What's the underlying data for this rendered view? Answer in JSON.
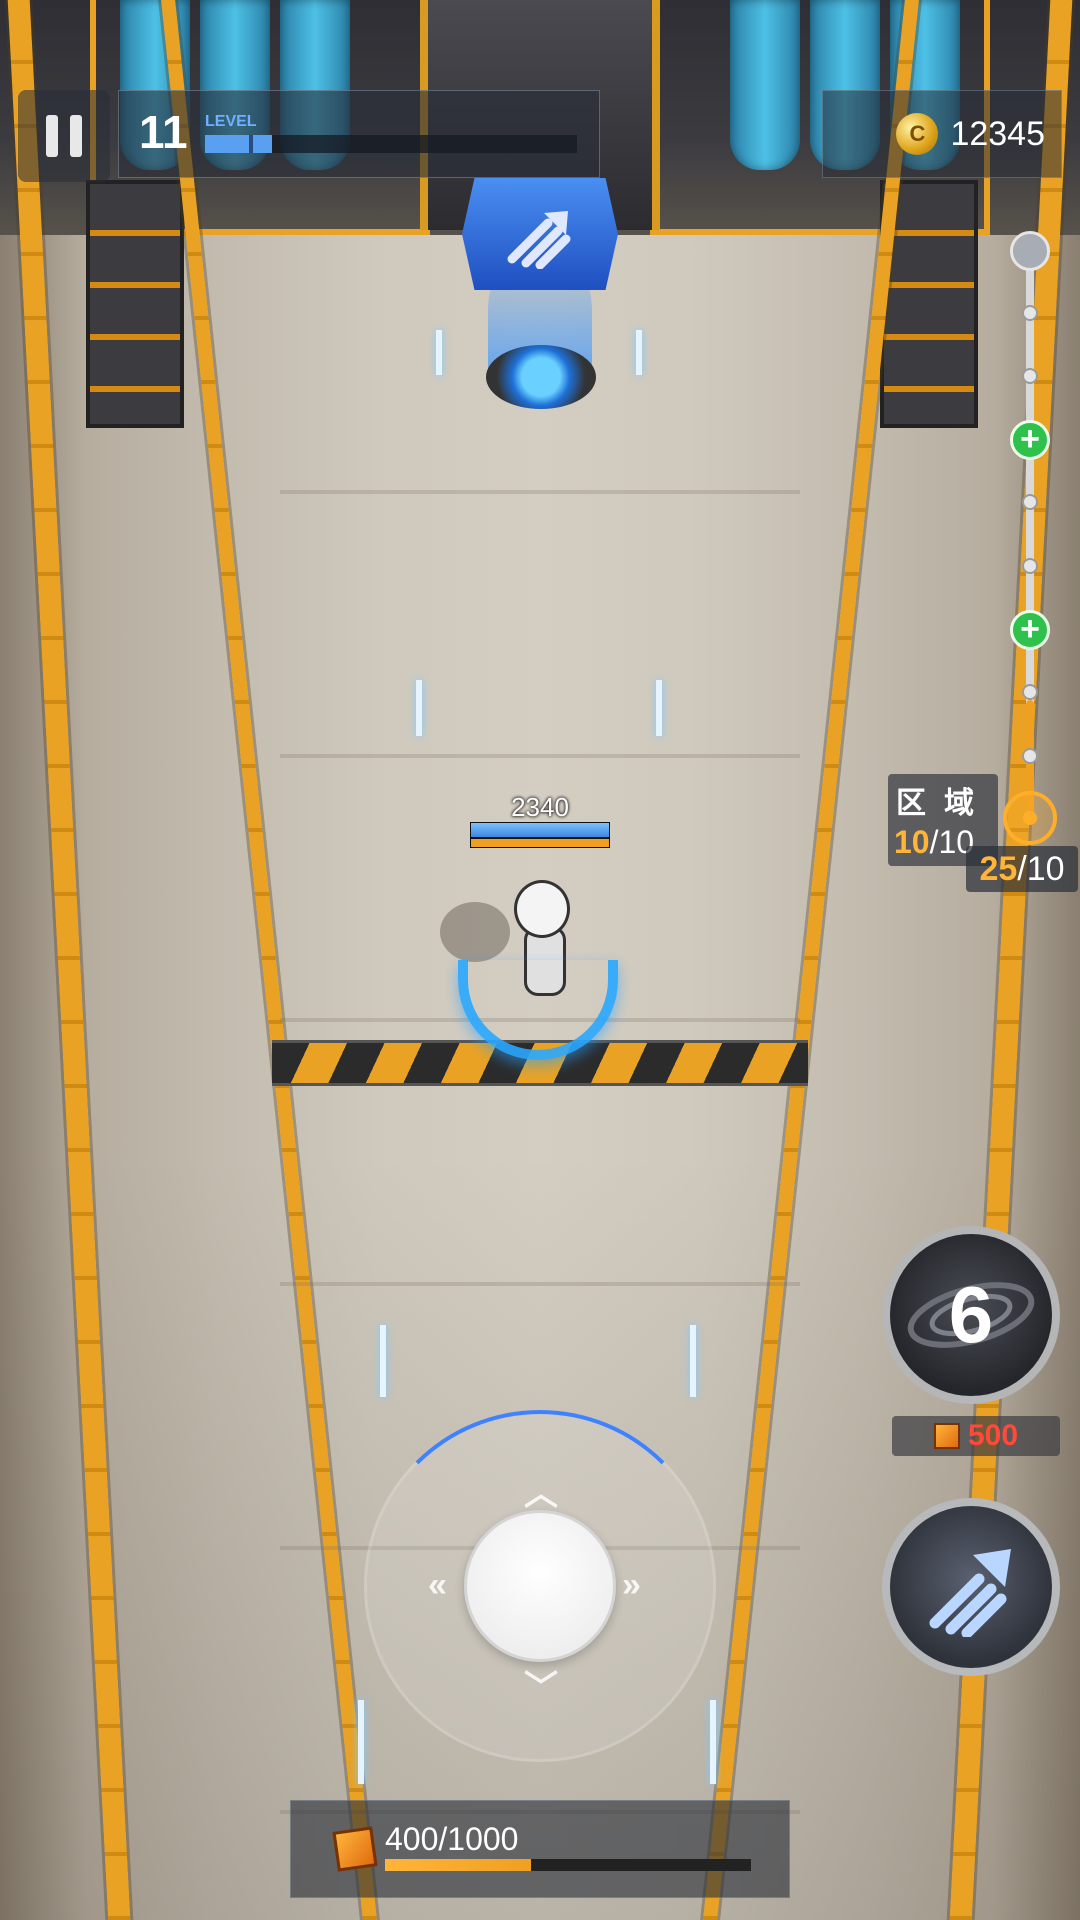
{
  "hud": {
    "level_value": "11",
    "level_word": "LEVEL",
    "level_progress": 0.18,
    "coins": "12345"
  },
  "zone": {
    "label": "区域",
    "current": "10",
    "total": "10"
  },
  "kills": {
    "current": "25",
    "total": "10"
  },
  "player": {
    "hp_value": "2340",
    "hp_fraction": 1.0,
    "shield_fraction": 1.0
  },
  "skill": {
    "count": "6",
    "cost": "500"
  },
  "resource": {
    "value": "400/1000",
    "fraction": 0.4
  },
  "route": {
    "nodes": [
      "start",
      "waypoint",
      "waypoint",
      "heal",
      "waypoint",
      "waypoint",
      "heal",
      "waypoint",
      "waypoint",
      "target"
    ]
  },
  "colors": {
    "accent_orange": "#f0a020",
    "accent_blue": "#3d86e0",
    "heal_green": "#2ec24c",
    "cost_red": "#ff4a3a"
  },
  "icons": {
    "pause": "pause-icon",
    "coin": "coin-icon",
    "heal": "heal-plus-icon",
    "target": "target-icon",
    "skill": "galaxy-icon",
    "dash": "dash-arrows-icon",
    "crate": "crate-icon"
  }
}
